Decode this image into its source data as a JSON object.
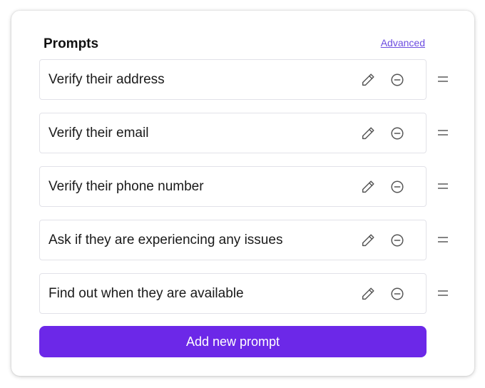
{
  "header": {
    "title": "Prompts",
    "advanced_link": "Advanced"
  },
  "prompts": [
    {
      "label": "Verify their address"
    },
    {
      "label": "Verify their email"
    },
    {
      "label": "Verify their phone number"
    },
    {
      "label": "Ask if they are experiencing any issues"
    },
    {
      "label": "Find out when they are available"
    }
  ],
  "icons": {
    "edit": "pencil-icon",
    "remove": "minus-circle-icon",
    "drag": "drag-handle-icon"
  },
  "add_button": {
    "label": "Add new prompt"
  },
  "colors": {
    "accent": "#6c28e8",
    "link": "#6c4ce0",
    "icon": "#555555",
    "border": "#e2e2e8"
  }
}
